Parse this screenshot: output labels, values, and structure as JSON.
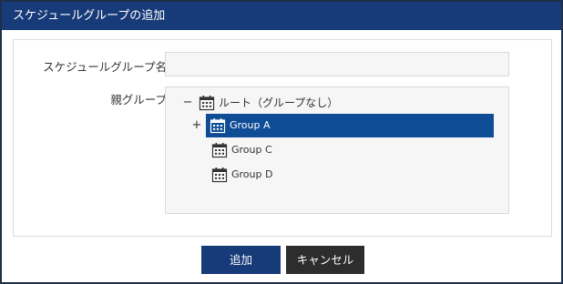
{
  "dialog": {
    "title": "スケジュールグループの追加"
  },
  "form": {
    "name_label": "スケジュールグループ名",
    "name_value": "",
    "parent_label": "親グループ"
  },
  "tree": {
    "root": {
      "toggle": "−",
      "label": "ルート（グループなし）"
    },
    "children": [
      {
        "toggle": "+",
        "label": "Group A",
        "selected": true
      },
      {
        "label": "Group C",
        "selected": false
      },
      {
        "label": "Group D",
        "selected": false
      }
    ]
  },
  "buttons": {
    "add": "追加",
    "cancel": "キャンセル"
  },
  "colors": {
    "titlebar": "#173a78",
    "selected": "#0f4c96",
    "add_button": "#173a78",
    "cancel_button": "#2d2d2d"
  },
  "icons": {
    "group": "calendar-group-icon"
  }
}
